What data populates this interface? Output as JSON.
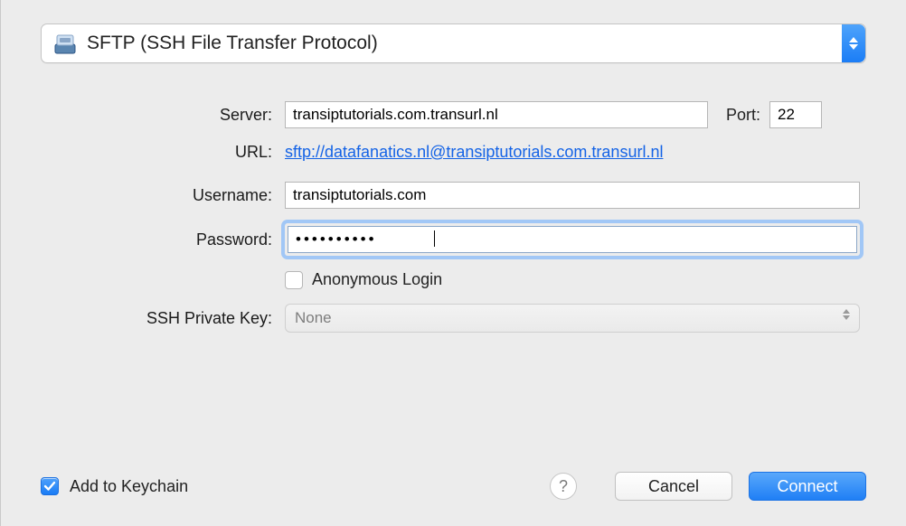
{
  "protocol": {
    "label": "SFTP (SSH File Transfer Protocol)"
  },
  "labels": {
    "server": "Server:",
    "port": "Port:",
    "url": "URL:",
    "username": "Username:",
    "password": "Password:",
    "anon": "Anonymous Login",
    "sshkey": "SSH Private Key:",
    "keychain": "Add to Keychain"
  },
  "values": {
    "server": "transiptutorials.com.transurl.nl",
    "port": "22",
    "url_text": "sftp://datafanatics.nl@transiptutorials.com.transurl.nl",
    "username": "transiptutorials.com",
    "password_mask": "••••••••••",
    "sshkey": "None"
  },
  "buttons": {
    "help": "?",
    "cancel": "Cancel",
    "connect": "Connect"
  }
}
